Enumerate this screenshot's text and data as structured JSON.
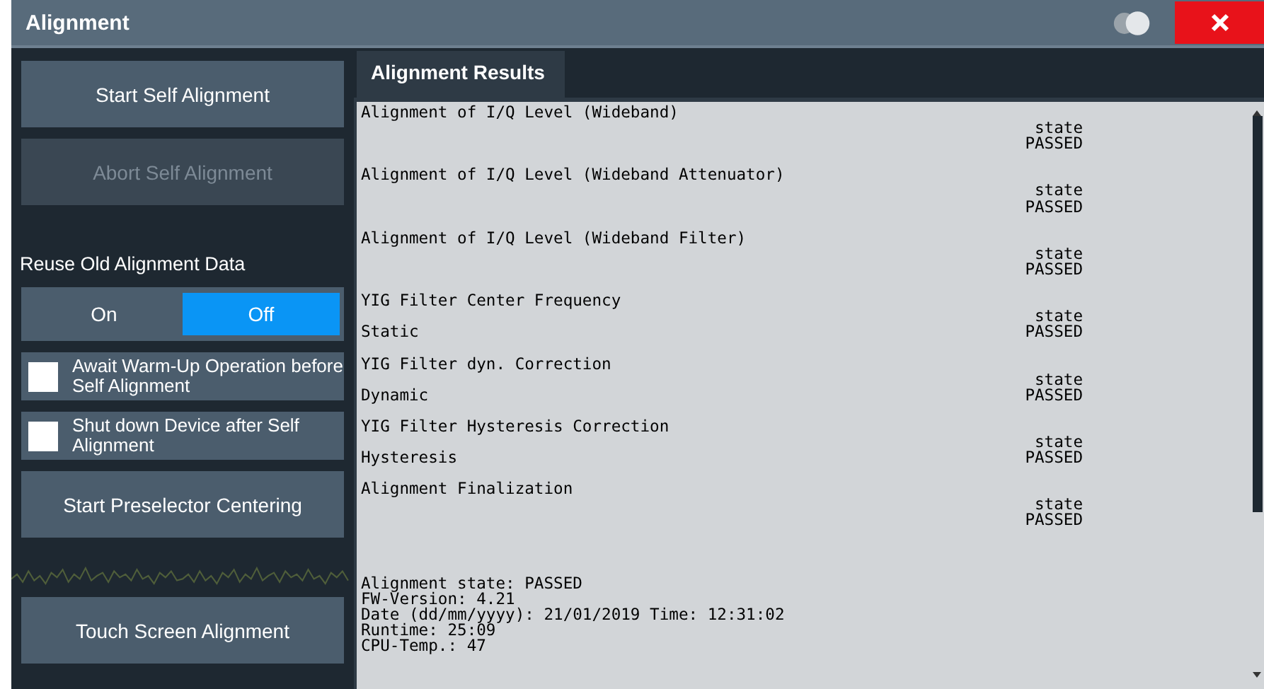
{
  "window": {
    "title": "Alignment"
  },
  "sidebar": {
    "buttons": [
      {
        "label": "Start Self Alignment",
        "disabled": false
      },
      {
        "label": "Abort Self Alignment",
        "disabled": true
      }
    ],
    "reuse_label": "Reuse Old Alignment Data",
    "reuse_options": [
      {
        "label": "On",
        "selected": false
      },
      {
        "label": "Off",
        "selected": true
      }
    ],
    "checkboxes": [
      {
        "label": "Await Warm-Up Operation before Self Alignment",
        "checked": false
      },
      {
        "label": "Shut down Device after Self Alignment",
        "checked": false
      }
    ],
    "preselector_button": "Start Preselector Centering",
    "touch_button": "Touch Screen Alignment"
  },
  "results": {
    "tab": "Alignment Results",
    "entries": [
      {
        "title": "Alignment of I/Q Level (Wideband)",
        "state_label": "state",
        "state": "PASSED"
      },
      {
        "title": "Alignment of I/Q Level (Wideband Attenuator)",
        "state_label": "state",
        "state": "PASSED"
      },
      {
        "title": "Alignment of I/Q Level (Wideband Filter)",
        "state_label": "state",
        "state": "PASSED"
      },
      {
        "title": "YIG Filter Center Frequency",
        "detail": "Static",
        "state_label": "state",
        "state": "PASSED"
      },
      {
        "title": "YIG Filter dyn. Correction",
        "detail": "Dynamic",
        "state_label": "state",
        "state": "PASSED"
      },
      {
        "title": "YIG Filter Hysteresis Correction",
        "detail": "Hysteresis",
        "state_label": "state",
        "state": "PASSED"
      },
      {
        "title": "Alignment Finalization",
        "state_label": "state",
        "state": "PASSED"
      }
    ],
    "summary": [
      "Alignment state: PASSED",
      "FW-Version: 4.21",
      "Date (dd/mm/yyyy): 21/01/2019 Time: 12:31:02",
      "Runtime: 25:09",
      "CPU-Temp.: 47"
    ]
  }
}
